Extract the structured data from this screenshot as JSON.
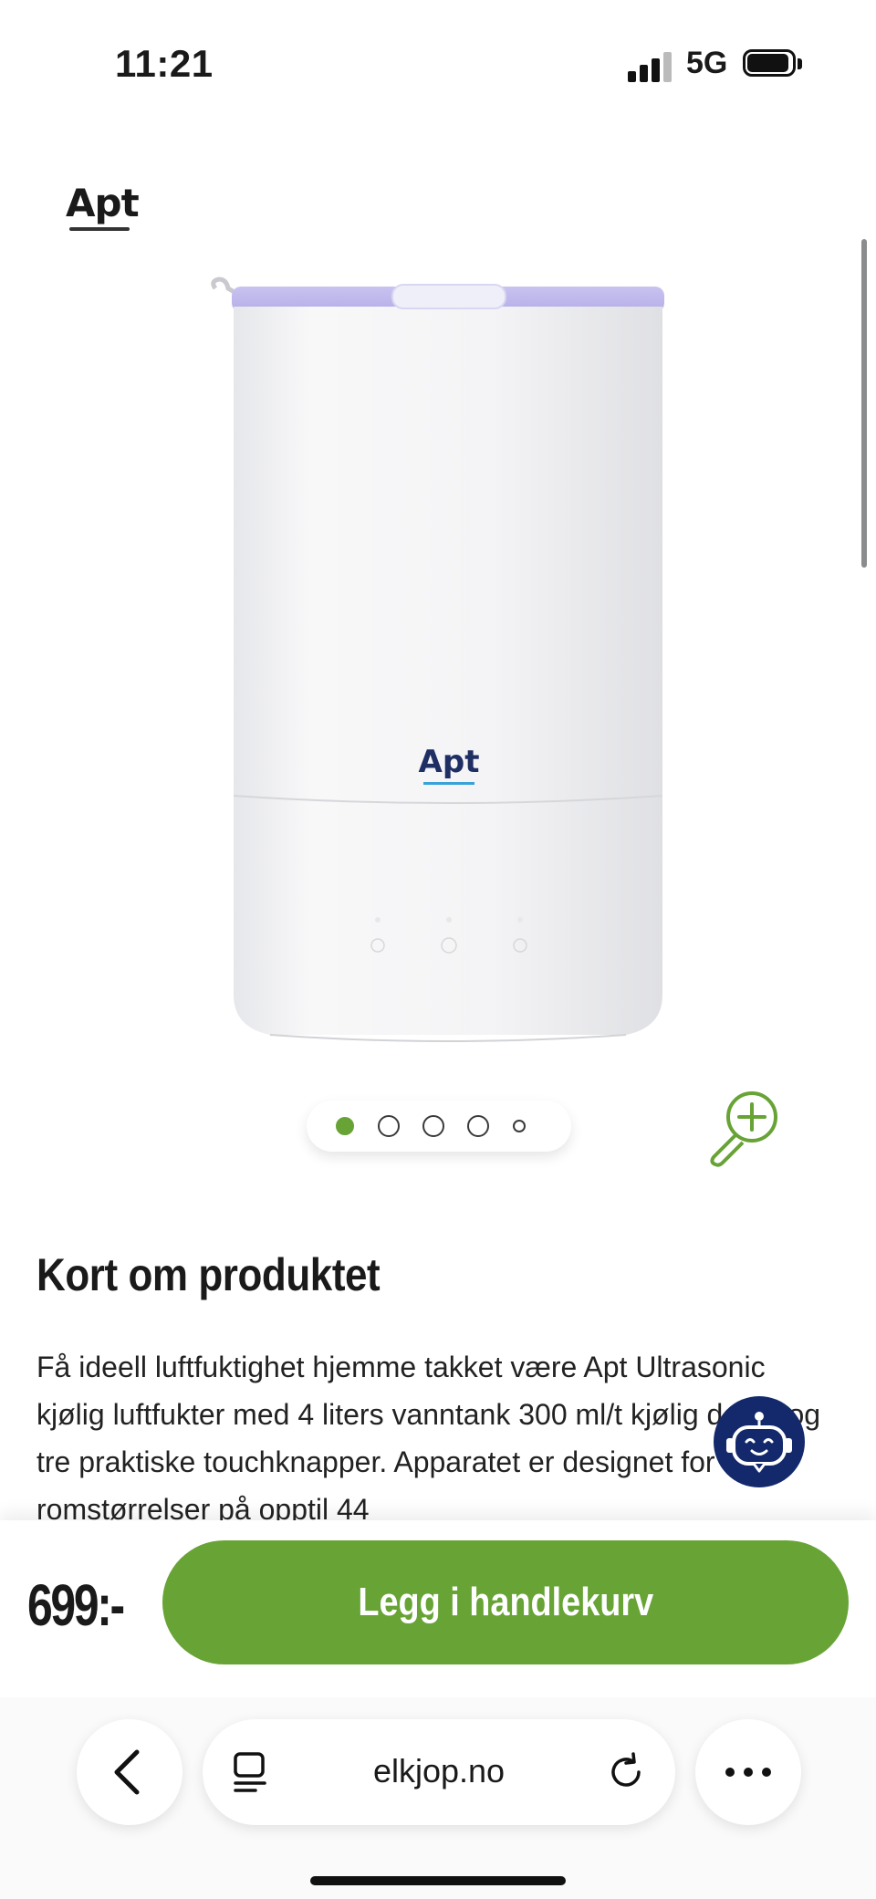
{
  "status_bar": {
    "time": "11:21",
    "network": "5G"
  },
  "brand": {
    "name": "Apt"
  },
  "product": {
    "image_logo": "Apt"
  },
  "carousel": {
    "dots": 5,
    "active_index": 0
  },
  "section": {
    "title": "Kort om produktet",
    "description": "Få ideell luftfuktighet hjemme takket være Apt Ultrasonic kjølig luftfukter med 4 liters vanntank 300 ml/t kjølig damp og tre praktiske touchknapper. Apparatet er designet for romstørrelser på opptil 44"
  },
  "purchase": {
    "price": "699:-",
    "add_to_cart_label": "Legg i handlekurv"
  },
  "browser": {
    "url": "elkjop.no"
  },
  "colors": {
    "accent_green": "#67a335",
    "chatbot_navy": "#13296b"
  },
  "icons": [
    "signal-icon",
    "battery-icon",
    "zoom-in-icon",
    "chatbot-icon",
    "back-icon",
    "tabs-icon",
    "reload-icon",
    "more-icon"
  ]
}
